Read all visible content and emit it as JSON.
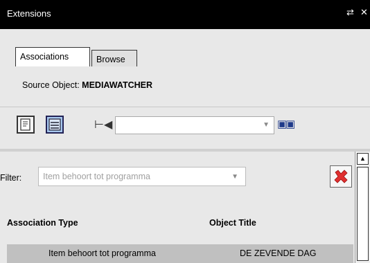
{
  "window": {
    "title": "Extensions",
    "restore_glyph": "⇄",
    "close_glyph": "✕"
  },
  "tabs": [
    {
      "label": "Associations",
      "active": true
    },
    {
      "label": "Browse",
      "active": false
    }
  ],
  "source": {
    "label": "Source Object:",
    "value": "MEDIAWATCHER"
  },
  "toolbar": {
    "icons": [
      "document-view-icon",
      "list-view-icon",
      "pin-icon",
      "link-icon"
    ],
    "combo_value": ""
  },
  "filter": {
    "label": "Filter:",
    "placeholder": "Item behoort tot programma"
  },
  "table": {
    "columns": [
      "Association Type",
      "Object Title"
    ],
    "rows": [
      {
        "type": "Item behoort tot programma",
        "title": "DE ZEVENDE DAG"
      }
    ]
  },
  "colors": {
    "titlebar": "#000000",
    "panel": "#e8e8e8",
    "selected_row": "#c0c0c0",
    "delete": "#e03030"
  }
}
